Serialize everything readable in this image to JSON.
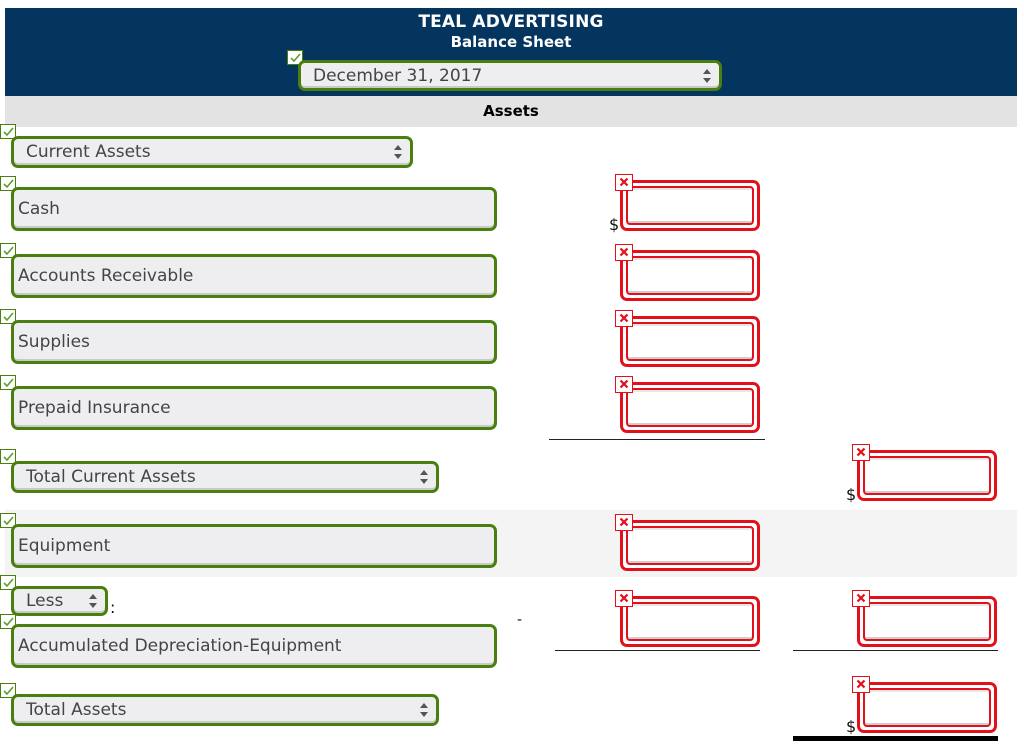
{
  "header": {
    "company": "TEAL ADVERTISING",
    "statement": "Balance Sheet",
    "date_select": {
      "value": "December 31, 2017",
      "status": "correct"
    }
  },
  "section_title": "Assets",
  "colors": {
    "header_bg": "#03355f",
    "correct": "#4a7f10",
    "incorrect": "#e3101b"
  },
  "rows": {
    "current_assets_heading": {
      "value": "Current Assets",
      "type": "select",
      "status": "correct"
    },
    "cash": {
      "label": "Cash",
      "status": "correct",
      "amount": "",
      "amount_status": "incorrect",
      "currency": "$"
    },
    "accounts_receivable": {
      "label": "Accounts Receivable",
      "status": "correct",
      "amount": "",
      "amount_status": "incorrect"
    },
    "supplies": {
      "label": "Supplies",
      "status": "correct",
      "amount": "",
      "amount_status": "incorrect"
    },
    "prepaid_insurance": {
      "label": "Prepaid Insurance",
      "status": "correct",
      "amount": "",
      "amount_status": "incorrect"
    },
    "total_current_assets": {
      "value": "Total Current Assets",
      "type": "select",
      "status": "correct",
      "amount": "",
      "amount_status": "incorrect",
      "currency": "$"
    },
    "equipment": {
      "label": "Equipment",
      "status": "correct",
      "amount": "",
      "amount_status": "incorrect"
    },
    "less_select": {
      "value": "Less",
      "status": "correct",
      "suffix": ":"
    },
    "accumulated_depreciation": {
      "label": "Accumulated Depreciation-Equipment",
      "status": "correct",
      "amount": "",
      "amount_status": "incorrect",
      "net_amount": "",
      "net_amount_status": "incorrect",
      "dash": "-"
    },
    "total_assets": {
      "value": "Total Assets",
      "type": "select",
      "status": "correct",
      "amount": "",
      "amount_status": "incorrect",
      "currency": "$"
    }
  },
  "icons": {
    "correct": "checkmark-icon",
    "incorrect": "x-mark-icon",
    "select": "select-arrows-icon"
  }
}
